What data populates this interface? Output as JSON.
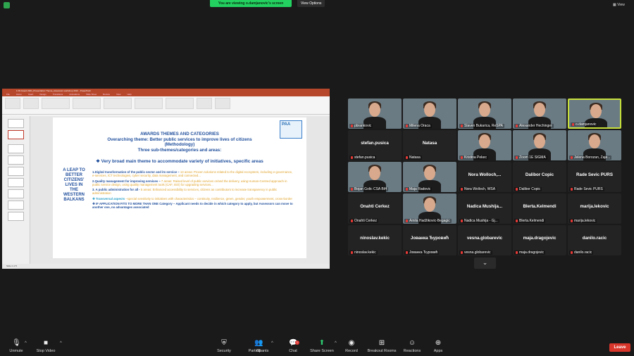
{
  "header": {
    "viewing_text": "You are viewing o.damjanovic's screen",
    "view_options": "View Options",
    "view_label": "View"
  },
  "ppt": {
    "title_bar": "1 PA Award 2021_Presentation Theme_Assessors workshop 2021 - PowerPoint",
    "tabs": [
      "File",
      "Home",
      "Insert",
      "Design",
      "Transitions",
      "Animations",
      "Slide Show",
      "Review",
      "View",
      "Help"
    ],
    "status": "Slide 2 of 5"
  },
  "slide": {
    "heading_lines": [
      "AWARDS THEMES AND CATEGORIES",
      "Overarching theme: Better public services to improve lives of citizens",
      "(Methodology)",
      "Three sub-themes/categories and areas:"
    ],
    "bullet": "❖  Very broad main theme to accommodate variety of initiatives, specific areas",
    "left_block": "A LEAP TO BETTER CITIZENS' LIVES IN THE WESTERN BALKANS",
    "items": [
      {
        "bold": "1.Digital transformation of the public sector and its service –",
        "rest": " 13 areas: Proven solutions related to the digital ecosystem, including e-governance, e-services, ICT technologies, cyber security, data management, and connected..."
      },
      {
        "bold": "2.Quality management for improving services –",
        "rest": " 7 areas: Raised level of public services or/and the delivery, using Human-Centred approach in public service design, using quality management tools (CAF, ISO) for upgrading services..."
      },
      {
        "bold": "3. A public administration for all -",
        "rest": " 5 areas: Enhanced accessibility to services, citizens as contributors to increase transparency in public administration"
      },
      {
        "bold": "❖  Transversal aspects",
        "rest": " –special sensitivity to initiatives with characteristics – continuity, resilience, green, gender, youth empowerment, cross-border"
      },
      {
        "bold": "❖  IF APPLICATION FITS TO MORE THAN ONE Category – Applicant needs to decide in which category to apply, but Assessors can move to another one, no advantages associated",
        "rest": ""
      }
    ],
    "logo_text": "PAA"
  },
  "participants": [
    {
      "label": "pbrankovic",
      "name": "",
      "video": true
    },
    {
      "label": "Milena Oraca",
      "name": "",
      "video": true
    },
    {
      "label": "Slaven Bukarica, ReSPA",
      "name": "",
      "video": true
    },
    {
      "label": "Alexander Hechinger",
      "name": "",
      "video": true
    },
    {
      "label": "o.damjanovic",
      "name": "",
      "video": true,
      "active": true
    },
    {
      "label": "stefan.pusica",
      "name": "stefan.pusica",
      "video": false
    },
    {
      "label": "Natasa",
      "name": "Natasa",
      "video": false
    },
    {
      "label": "Kristina Pekec",
      "name": "",
      "video": true
    },
    {
      "label": "Zoom 1E SIGMA",
      "name": "",
      "video": true
    },
    {
      "label": "Jelena Borozan, Zaje...",
      "name": "",
      "video": true
    },
    {
      "label": "Bojan Golic CSA BiH",
      "name": "",
      "video": true
    },
    {
      "label": "Maja Radovic",
      "name": "",
      "video": true
    },
    {
      "label": "Nora Wolloch, WSA",
      "name": "Nora Wolloch,...",
      "video": false
    },
    {
      "label": "Dalibor Copic",
      "name": "Dalibor Copic",
      "video": false
    },
    {
      "label": "Rade Sevic PURS",
      "name": "Rade Sevic PURS",
      "video": false
    },
    {
      "label": "Onahti Čerkez",
      "name": "Onahti Čerkez",
      "video": false
    },
    {
      "label": "Amila Hadžikovic-Begagic",
      "name": "",
      "video": true
    },
    {
      "label": "Nadica Mushija - Gj...",
      "name": "Nadica Mushija...",
      "video": false
    },
    {
      "label": "Blerta.Kelmendi",
      "name": "Blerta.Kelmendi",
      "video": false
    },
    {
      "label": "marija.lekovic",
      "name": "marija.lekovic",
      "video": false
    },
    {
      "label": "ninoslav.kekic",
      "name": "ninoslav.kekic",
      "video": false
    },
    {
      "label": "Јованка Ђуровић",
      "name": "Јованка Ђуровић",
      "video": false
    },
    {
      "label": "vesna.globarevic",
      "name": "vesna.globarevic",
      "video": false
    },
    {
      "label": "maja.dragojevic",
      "name": "maja.dragojevic",
      "video": false
    },
    {
      "label": "danilo.racic",
      "name": "danilo.racic",
      "video": false
    }
  ],
  "toolbar": {
    "unmute": "Unmute",
    "stop_video": "Stop Video",
    "security": "Security",
    "participants": "Participants",
    "participants_count": "68",
    "chat": "Chat",
    "chat_badge": "1",
    "share_screen": "Share Screen",
    "record": "Record",
    "breakout": "Breakout Rooms",
    "reactions": "Reactions",
    "apps": "Apps",
    "leave": "Leave"
  }
}
